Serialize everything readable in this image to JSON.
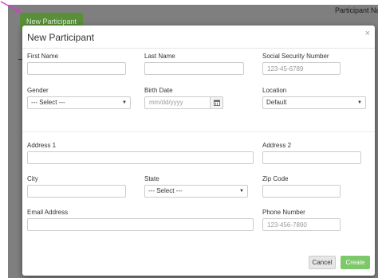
{
  "background": {
    "new_participant_button": "New Participant",
    "column_header": "Participant Nam"
  },
  "modal": {
    "title": "New Participant",
    "close_label": "×",
    "fields": {
      "first_name": {
        "label": "First Name",
        "value": "",
        "placeholder": ""
      },
      "last_name": {
        "label": "Last Name",
        "value": "",
        "placeholder": ""
      },
      "ssn": {
        "label": "Social Security Number",
        "value": "",
        "placeholder": "123-45-6789"
      },
      "gender": {
        "label": "Gender",
        "selected": "--- Select ---"
      },
      "birth_date": {
        "label": "Birth Date",
        "placeholder": "mm/dd/yyyy"
      },
      "location": {
        "label": "Location",
        "selected": "Default"
      },
      "address1": {
        "label": "Address 1",
        "value": "",
        "placeholder": ""
      },
      "address2": {
        "label": "Address 2",
        "value": "",
        "placeholder": ""
      },
      "city": {
        "label": "City",
        "value": "",
        "placeholder": ""
      },
      "state": {
        "label": "State",
        "selected": "--- Select ---"
      },
      "zip": {
        "label": "Zip Code",
        "value": "",
        "placeholder": ""
      },
      "email": {
        "label": "Email Address",
        "value": "",
        "placeholder": ""
      },
      "phone": {
        "label": "Phone Number",
        "value": "",
        "placeholder": "123-456-7890"
      }
    },
    "buttons": {
      "cancel": "Cancel",
      "create": "Create"
    }
  },
  "icons": {
    "dropdown": "caret-down-icon",
    "calendar": "calendar-icon",
    "close": "close-icon"
  },
  "colors": {
    "create_button": "#7cc86a",
    "background_button": "#5a8f3a",
    "overlay": "#7f7f7f",
    "annotation_arrow": "#d23cc8"
  }
}
